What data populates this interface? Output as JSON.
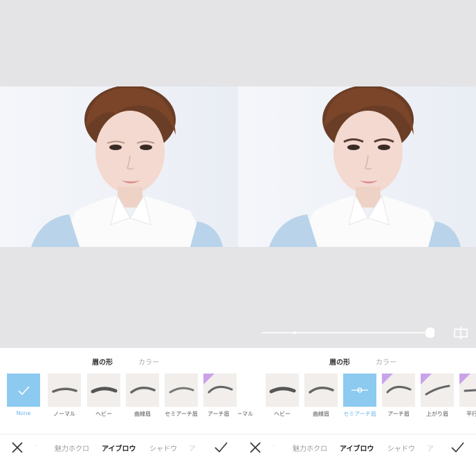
{
  "left": {
    "tabs": {
      "shape": "眉の形",
      "color": "カラー"
    },
    "styles": [
      {
        "label": "None",
        "selected": true,
        "pro": false
      },
      {
        "label": "ノーマル",
        "selected": false,
        "pro": false
      },
      {
        "label": "ヘビー",
        "selected": false,
        "pro": false
      },
      {
        "label": "曲線眉",
        "selected": false,
        "pro": false
      },
      {
        "label": "セミアーチ眉",
        "selected": false,
        "pro": false
      },
      {
        "label": "アーチ眉",
        "selected": false,
        "pro": true
      }
    ],
    "toolbar": {
      "mole": "魅力ホクロ",
      "eyebrow": "アイブロウ",
      "shadow": "シャドウ",
      "more": "ア"
    }
  },
  "right": {
    "tabs": {
      "shape": "眉の形",
      "color": "カラー"
    },
    "styles": [
      {
        "label": "ーマル",
        "selected": false,
        "pro": false
      },
      {
        "label": "ヘビー",
        "selected": false,
        "pro": false
      },
      {
        "label": "曲線眉",
        "selected": false,
        "pro": false
      },
      {
        "label": "セミアーチ眉",
        "selected": true,
        "pro": false
      },
      {
        "label": "アーチ眉",
        "selected": false,
        "pro": true
      },
      {
        "label": "上がり眉",
        "selected": false,
        "pro": true
      },
      {
        "label": "平行",
        "selected": false,
        "pro": true
      }
    ],
    "toolbar": {
      "mole": "魅力ホクロ",
      "eyebrow": "アイブロウ",
      "shadow": "シャドウ",
      "more": "ア"
    },
    "slider": {
      "value": 1.0,
      "icon": "compare-icon"
    }
  },
  "colors": {
    "accent": "#8ccaf0",
    "selected_text": "#6bb8e8",
    "pro_badge": "#c9a3ea"
  }
}
